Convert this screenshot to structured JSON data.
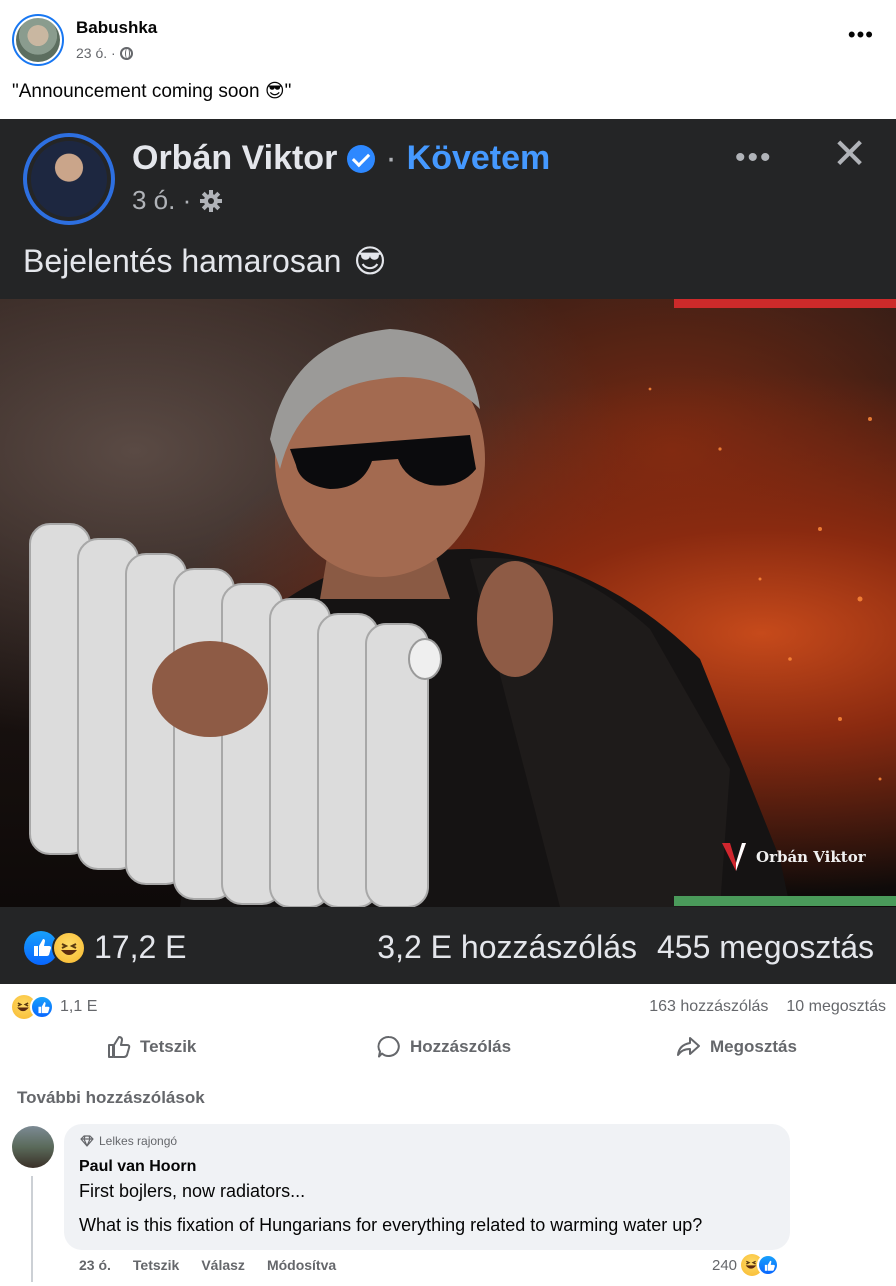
{
  "post": {
    "author": "Babushka",
    "time": "23 ó. ·",
    "text": "\"Announcement coming soon 😎\""
  },
  "embedded": {
    "author": "Orbán Viktor",
    "separator": "·",
    "follow": "Követem",
    "time": "3 ó. ·",
    "text": "Bejelentés hamarosan",
    "emoji": "😎",
    "watermark": "Orbán Viktor",
    "reactions_count": "17,2 E",
    "comments": "3,2 E hozzászólás",
    "shares": "455 megosztás",
    "colors": {
      "flag_red": "#cd2a2a",
      "flag_green": "#4a9a5a",
      "follow": "#4599ff"
    }
  },
  "stats": {
    "reactions_count": "1,1 E",
    "comments": "163 hozzászólás",
    "shares": "10 megosztás"
  },
  "actions": {
    "like": "Tetszik",
    "comment": "Hozzászólás",
    "share": "Megosztás"
  },
  "more_comments": "További hozzászólások",
  "comment": {
    "badge": "Lelkes rajongó",
    "name": "Paul van Hoorn",
    "line1": "First bojlers, now radiators...",
    "line2": "What is this fixation of Hungarians for everything related to warming water up?",
    "time": "23 ó.",
    "like": "Tetszik",
    "reply": "Válasz",
    "edited": "Módosítva",
    "reactions_count": "240"
  }
}
